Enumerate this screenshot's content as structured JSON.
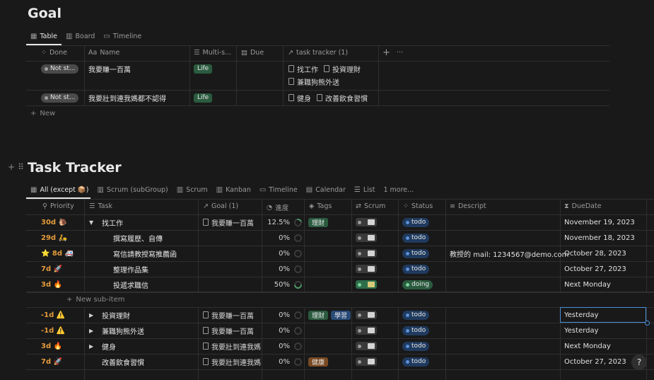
{
  "goal": {
    "title": "Goal",
    "tabs": [
      {
        "label": "Table",
        "icon": "table-icon",
        "active": true
      },
      {
        "label": "Board",
        "icon": "board-icon",
        "active": false
      },
      {
        "label": "Timeline",
        "icon": "timeline-icon",
        "active": false
      }
    ],
    "headers": {
      "done": "Done",
      "name": "Name",
      "name_prefix": "Aa",
      "multi": "Multi-s...",
      "due": "Due",
      "tracker": "task tracker (1)",
      "add": "+",
      "more": "···"
    },
    "rows": [
      {
        "status": "Not st...",
        "name": "我要賺一百萬",
        "tag": "Life",
        "tracker": [
          "找工作",
          "投資理財",
          "兼職狗熊外送"
        ]
      },
      {
        "status": "Not st...",
        "name": "我要壯到連我媽都不認得",
        "tag": "Life",
        "tracker": [
          "健身",
          "改善飲食習慣"
        ]
      }
    ],
    "new_label": "New"
  },
  "tracker": {
    "title": "Task Tracker",
    "tabs": [
      {
        "label": "All (except 📦)",
        "active": true
      },
      {
        "label": "Scrum (subGroup)",
        "active": false
      },
      {
        "label": "Scrum",
        "active": false
      },
      {
        "label": "Kanban",
        "active": false
      },
      {
        "label": "Timeline",
        "active": false
      },
      {
        "label": "Calendar",
        "active": false
      },
      {
        "label": "List",
        "active": false
      },
      {
        "label": "1 more...",
        "active": false
      }
    ],
    "headers": {
      "priority": "Priority",
      "task": "Task",
      "goal": "Goal (1)",
      "progress": "進度",
      "tags": "Tags",
      "scrum": "Scrum",
      "status": "Status",
      "descript": "Descript",
      "duedate": "DueDate"
    },
    "rows": [
      {
        "priority": "30d 🐌",
        "arrow": "▼",
        "task": "找工作",
        "indent": 0,
        "goal": "我要賺一百萬",
        "progress": "12.5%",
        "ring": "small",
        "tags": [
          {
            "t": "理財",
            "c": "#2b5b3f"
          }
        ],
        "scrum_on": false,
        "status": "todo",
        "descript": "",
        "due": "November 19, 2023"
      },
      {
        "priority": "29d 🛵",
        "arrow": "",
        "task": "撰寫履歷、自傳",
        "indent": 1,
        "goal": "",
        "progress": "0%",
        "ring": "empty",
        "tags": [],
        "scrum_on": false,
        "status": "todo",
        "descript": "",
        "due": "November 18, 2023"
      },
      {
        "priority": "⭐ 8d 🚑",
        "arrow": "",
        "task": "寫信請教授寫推薦函",
        "indent": 1,
        "goal": "",
        "progress": "0%",
        "ring": "empty",
        "tags": [],
        "scrum_on": false,
        "status": "todo",
        "descript": "教授的 mail: 1234567@demo.com",
        "due": "October 28, 2023"
      },
      {
        "priority": "7d 🚀",
        "arrow": "",
        "task": "整理作品集",
        "indent": 1,
        "goal": "",
        "progress": "0%",
        "ring": "empty",
        "tags": [],
        "scrum_on": false,
        "status": "todo",
        "descript": "",
        "due": "October 27, 2023"
      },
      {
        "priority": "3d 🔥",
        "arrow": "",
        "task": "投遞求職信",
        "indent": 1,
        "goal": "",
        "progress": "50%",
        "ring": "half",
        "tags": [],
        "scrum_on": true,
        "status": "doing",
        "descript": "",
        "due": "Next Monday"
      },
      {
        "priority": "-1d ⚠️",
        "arrow": "▶",
        "task": "投資理財",
        "indent": 0,
        "goal": "我要賺一百萬",
        "progress": "0%",
        "ring": "empty",
        "tags": [
          {
            "t": "理財",
            "c": "#2b5b3f"
          },
          {
            "t": "學習",
            "c": "#284a77"
          }
        ],
        "scrum_on": false,
        "status": "todo",
        "descript": "",
        "due": "Yesterday"
      },
      {
        "priority": "-1d ⚠️",
        "arrow": "▶",
        "task": "兼職狗熊外送",
        "indent": 0,
        "goal": "我要賺一百萬",
        "progress": "0%",
        "ring": "empty",
        "tags": [],
        "scrum_on": false,
        "status": "todo",
        "descript": "",
        "due": "Yesterday"
      },
      {
        "priority": "3d 🔥",
        "arrow": "▶",
        "task": "健身",
        "indent": 0,
        "goal": "我要壯到連我媽都不",
        "progress": "0%",
        "ring": "empty",
        "tags": [],
        "scrum_on": false,
        "status": "todo",
        "descript": "",
        "due": "Next Monday"
      },
      {
        "priority": "7d 🚀",
        "arrow": "",
        "task": "改善飲食習慣",
        "indent": 0,
        "goal": "我要壯到連我媽都不",
        "progress": "0%",
        "ring": "empty",
        "tags": [
          {
            "t": "健康",
            "c": "#7a4a23"
          }
        ],
        "scrum_on": false,
        "status": "todo",
        "descript": "",
        "due": "October 27, 2023"
      }
    ],
    "new_subitem": "New sub-item",
    "help": "?"
  },
  "colors": {
    "todo_dot": "#5b8fd9",
    "todo_bg": "#1f3a5e",
    "doing_dot": "#7bd19b",
    "doing_bg": "#2b5b3f",
    "life_bg": "#2b5b3f",
    "notstarted_bg": "#4a4a4a"
  }
}
